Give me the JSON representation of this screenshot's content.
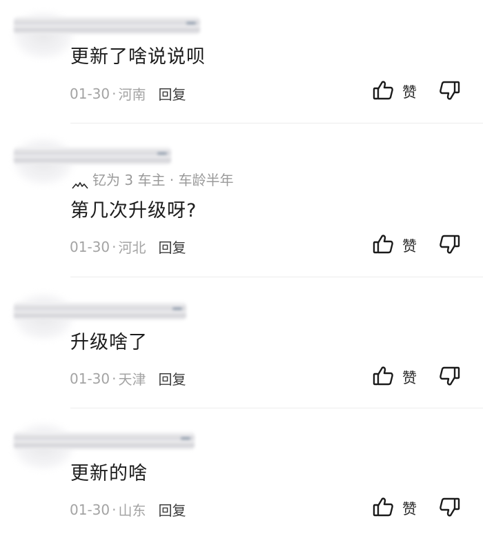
{
  "comments": [
    {
      "text": "更新了啥说说呗",
      "date": "01-30",
      "location": "河南",
      "reply": "回复",
      "like": "赞"
    },
    {
      "badge": "钇为 3 车主 · 车龄半年",
      "text": "第几次升级呀?",
      "date": "01-30",
      "location": "河北",
      "reply": "回复",
      "like": "赞"
    },
    {
      "text": "升级啥了",
      "date": "01-30",
      "location": "天津",
      "reply": "回复",
      "like": "赞"
    },
    {
      "text": "更新的啥",
      "date": "01-30",
      "location": "山东",
      "reply": "回复",
      "like": "赞"
    }
  ],
  "separator": "·",
  "icons": {
    "like": "thumbs-up-icon",
    "dislike": "thumbs-down-icon",
    "badge": "mountain-logo-icon"
  }
}
